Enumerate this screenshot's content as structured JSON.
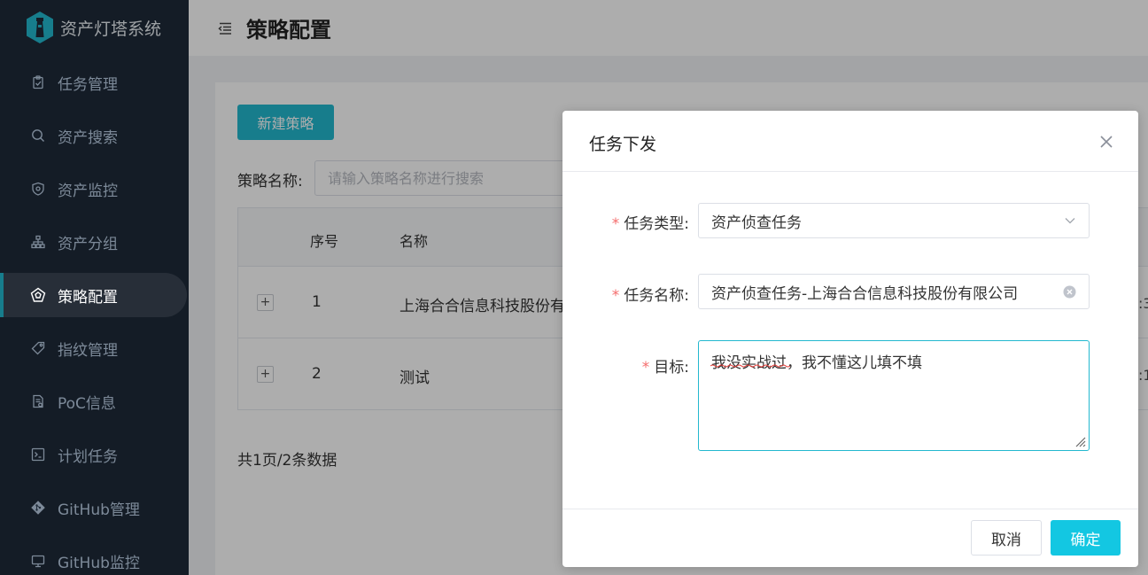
{
  "app": {
    "title": "资产灯塔系统"
  },
  "sidebar": {
    "items": [
      {
        "label": "任务管理",
        "icon": "clipboard-icon",
        "active": false
      },
      {
        "label": "资产搜索",
        "icon": "search-icon",
        "active": false
      },
      {
        "label": "资产监控",
        "icon": "shield-icon",
        "active": false
      },
      {
        "label": "资产分组",
        "icon": "org-chart-icon",
        "active": false
      },
      {
        "label": "策略配置",
        "icon": "pentagon-icon",
        "active": true
      },
      {
        "label": "指纹管理",
        "icon": "tag-icon",
        "active": false
      },
      {
        "label": "PoC信息",
        "icon": "document-icon",
        "active": false
      },
      {
        "label": "计划任务",
        "icon": "terminal-icon",
        "active": false
      },
      {
        "label": "GitHub管理",
        "icon": "git-icon",
        "active": false
      },
      {
        "label": "GitHub监控",
        "icon": "monitor-icon",
        "active": false
      }
    ]
  },
  "header": {
    "page_title": "策略配置",
    "fold_icon": "menu-fold-icon"
  },
  "main": {
    "new_button": "新建策略",
    "search_label": "策略名称:",
    "search_placeholder": "请输入策略名称进行搜索",
    "table": {
      "columns": [
        "序号",
        "名称"
      ],
      "rows": [
        {
          "index": "1",
          "name": "上海合合信息科技股份有",
          "trailing": ":3"
        },
        {
          "index": "2",
          "name": "测试",
          "trailing": ":1"
        }
      ]
    },
    "pagination": "共1页/2条数据"
  },
  "dialog": {
    "title": "任务下发",
    "fields": {
      "type_label": "任务类型:",
      "type_value": "资产侦查任务",
      "name_label": "任务名称:",
      "name_value": "资产侦查任务-上海合合信息科技股份有限公司",
      "target_label": "目标:",
      "target_value": "我没实战过，我不懂这儿填不填"
    },
    "cancel": "取消",
    "ok": "确定"
  },
  "colors": {
    "accent": "#23b8cf",
    "sidebar_bg": "#1e2a38",
    "required": "#f56c6c"
  }
}
